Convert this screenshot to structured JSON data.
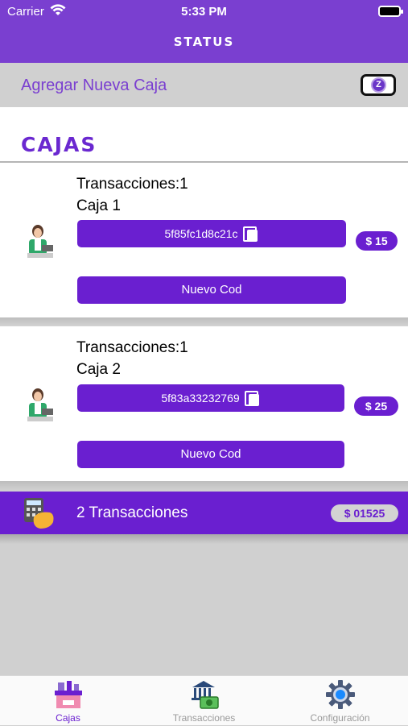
{
  "status_bar": {
    "carrier": "Carrier",
    "time": "5:33 PM"
  },
  "nav": {
    "title": "STATUS"
  },
  "add_bar": {
    "label": "Agregar Nueva Caja",
    "badge": "Z"
  },
  "section": {
    "heading": "CAJAS"
  },
  "cards": [
    {
      "transactions": "Transacciones:1",
      "name": "Caja 1",
      "code": "5f85fc1d8c21c",
      "amount": "$ 15",
      "button": "Nuevo Cod"
    },
    {
      "transactions": "Transacciones:1",
      "name": "Caja 2",
      "code": "5f83a33232769",
      "amount": "$ 25",
      "button": "Nuevo Cod"
    }
  ],
  "summary": {
    "label": "2 Transacciones",
    "total": "$ 01525"
  },
  "tabs": [
    {
      "label": "Cajas",
      "icon": "register-icon",
      "active": true
    },
    {
      "label": "Transacciones",
      "icon": "bank-icon",
      "active": false
    },
    {
      "label": "Configuración",
      "icon": "gear-icon",
      "active": false
    }
  ],
  "colors": {
    "primary": "#6a1fd0",
    "nav": "#7a3fd0",
    "background": "#d0d0d0"
  }
}
